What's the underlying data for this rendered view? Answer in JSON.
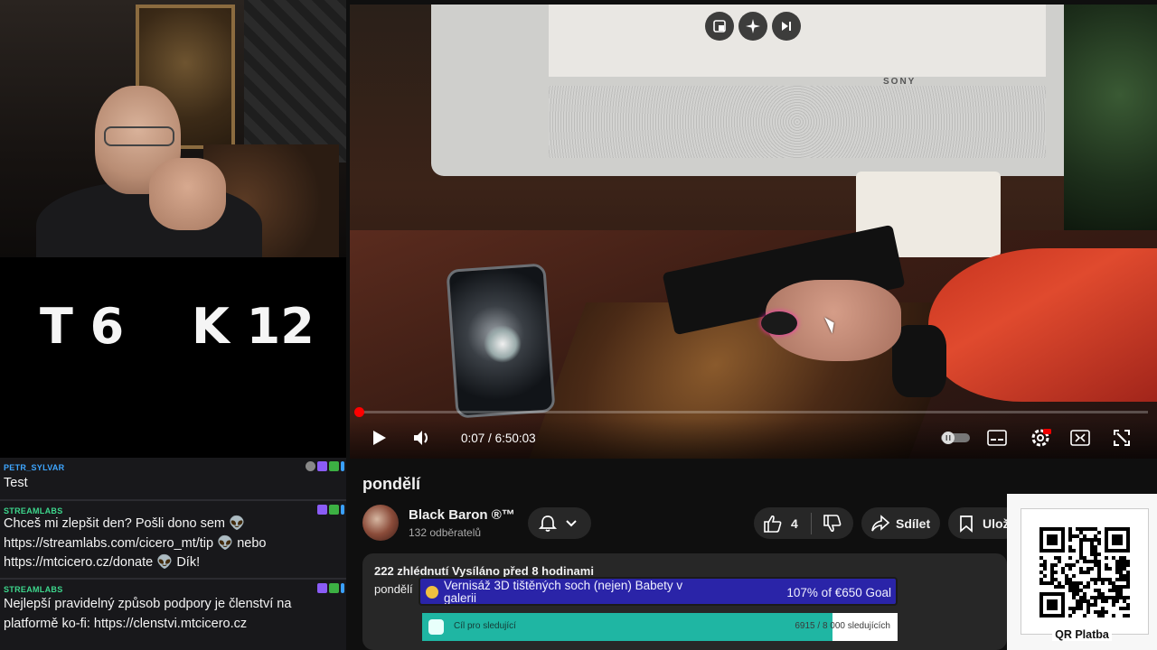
{
  "score": {
    "left": "T 6",
    "right": "K 12"
  },
  "chat": {
    "messages": [
      {
        "user": "PETR_SYLVAR",
        "user_color": "#3ea6ff",
        "text": "Test"
      },
      {
        "user": "STREAMLABS",
        "user_color": "#3dd68c",
        "text": "Chceš mi zlepšit den? Pošli dono sem 👽 https://streamlabs.com/cicero_mt/tip 👽 nebo https://mtcicero.cz/donate 👽 Dík!"
      },
      {
        "user": "STREAMLABS",
        "user_color": "#3dd68c",
        "text": "Nejlepší pravidelný způsob podpory je členství na platformě ko-fi: https://clenstvi.mtcicero.cz"
      }
    ]
  },
  "player": {
    "monitor_brand": "SONY",
    "time_current": "0:07",
    "time_separator": "/",
    "time_total": "6:50:03",
    "progress_fraction": 0.0003
  },
  "video": {
    "title": "pondělí",
    "channel_name": "Black Baron ®™",
    "channel_subscribers": "132 odběratelů",
    "like_count": "4",
    "share_label": "Sdílet",
    "save_label": "Ulož",
    "stats": "222 zhlédnutí  Vysíláno před 8 hodinami",
    "description": "pondělí"
  },
  "goal": {
    "title": "Vernisáž 3D tištěných soch (nejen) Babety v galerii",
    "amount": "107% of €650 Goal",
    "color": "#2a24a8"
  },
  "follower_goal": {
    "label": "Cíl pro sledující",
    "count": "6915 / 8 000 sledujících",
    "progress_fraction": 0.864,
    "color": "#1fb6a3"
  },
  "qr": {
    "label": "QR Platba"
  },
  "icons": {
    "miniplayer": "miniplayer-icon",
    "ai": "sparkle-icon",
    "skip": "skip-next-icon",
    "play": "play-icon",
    "volume": "volume-icon",
    "autoplay": "autoplay-toggle-icon",
    "subtitles": "subtitles-icon",
    "settings": "settings-icon",
    "cast": "theater-mode-icon",
    "fullscreen": "fullscreen-icon",
    "bell": "bell-icon",
    "like": "thumbs-up-icon",
    "dislike": "thumbs-down-icon",
    "share": "share-icon",
    "save": "bookmark-icon"
  }
}
